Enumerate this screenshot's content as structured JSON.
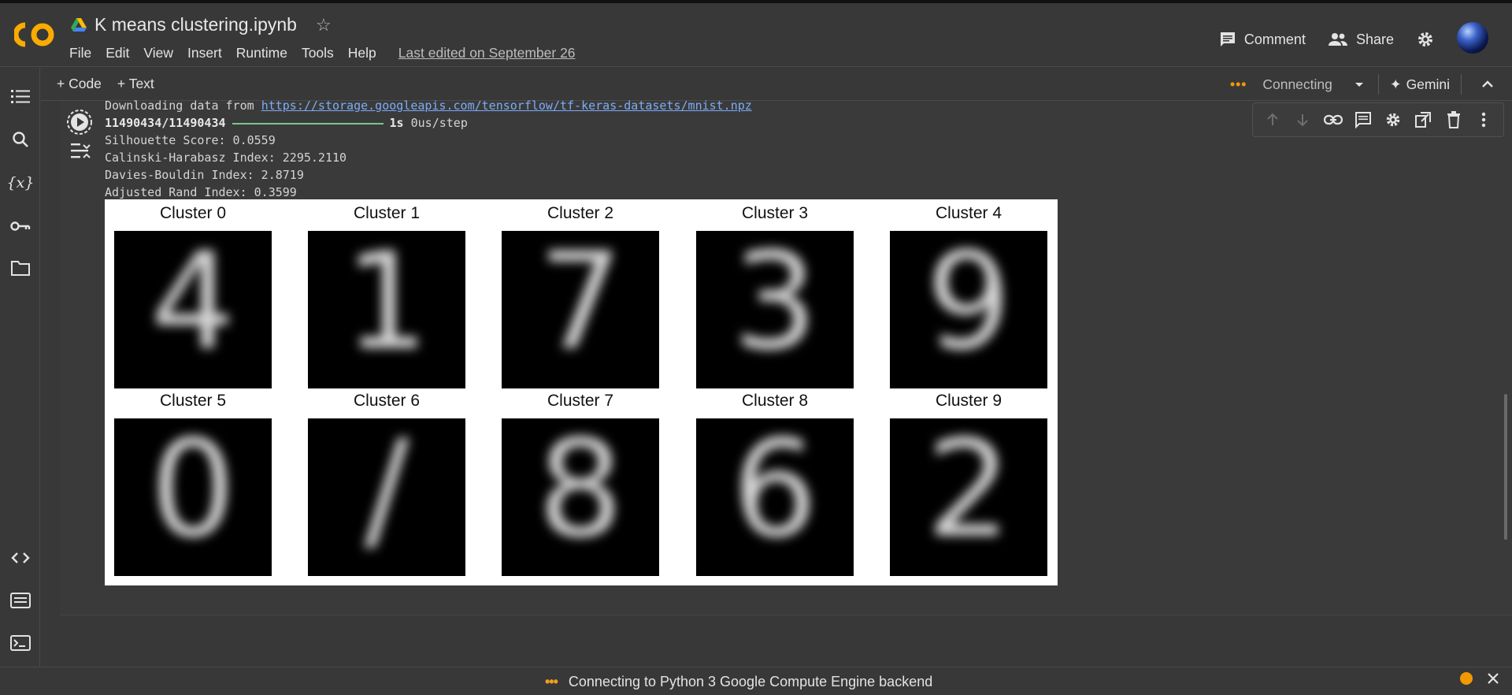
{
  "app": {
    "title": "K means clustering.ipynb",
    "last_edited": "Last edited on September 26",
    "menu": [
      "File",
      "Edit",
      "View",
      "Insert",
      "Runtime",
      "Tools",
      "Help"
    ],
    "comment_label": "Comment",
    "share_label": "Share"
  },
  "toolbar": {
    "code_label": "+ Code",
    "text_label": "+ Text",
    "connection_label": "Connecting",
    "gemini_label": "Gemini"
  },
  "output": {
    "download_prefix": "Downloading data from ",
    "download_url": "https://storage.googleapis.com/tensorflow/tf-keras-datasets/mnist.npz",
    "progress_count": "11490434/11490434",
    "progress_fraction": 1.0,
    "progress_time": "1s",
    "progress_rate": "0us/step",
    "silhouette": "Silhouette Score: 0.0559",
    "calinski": "Calinski-Harabasz Index: 2295.2110",
    "davies": "Davies-Bouldin Index: 2.8719",
    "rand": "Adjusted Rand Index: 0.3599"
  },
  "figure": {
    "clusters": [
      {
        "title": "Cluster 0",
        "digit": "4"
      },
      {
        "title": "Cluster 1",
        "digit": "1"
      },
      {
        "title": "Cluster 2",
        "digit": "7"
      },
      {
        "title": "Cluster 3",
        "digit": "3"
      },
      {
        "title": "Cluster 4",
        "digit": "9"
      },
      {
        "title": "Cluster 5",
        "digit": "0"
      },
      {
        "title": "Cluster 6",
        "digit": "/"
      },
      {
        "title": "Cluster 7",
        "digit": "8"
      },
      {
        "title": "Cluster 8",
        "digit": "6"
      },
      {
        "title": "Cluster 9",
        "digit": "2"
      }
    ]
  },
  "status": {
    "text": "Connecting to Python 3 Google Compute Engine backend"
  },
  "colors": {
    "background": "#383838",
    "accent_orange": "#f29900",
    "link_blue": "#7cacf8",
    "progress_green": "#7cc490"
  }
}
